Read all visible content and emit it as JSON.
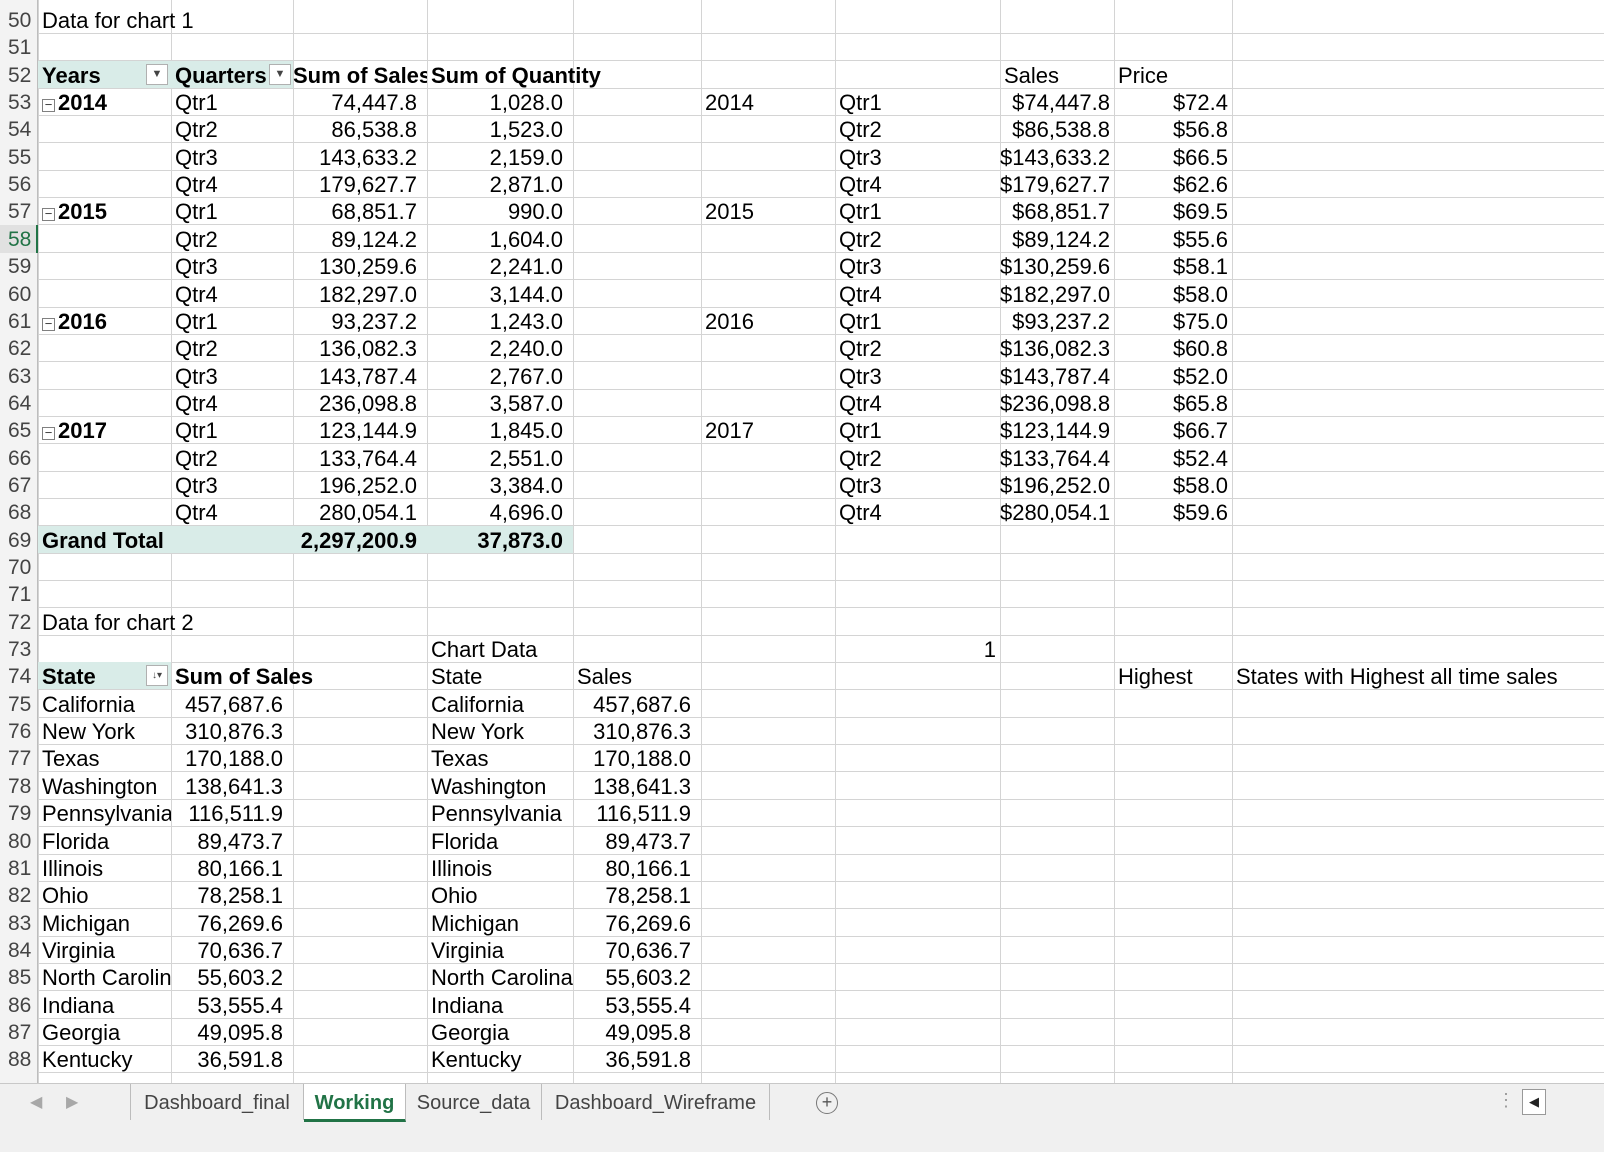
{
  "row_numbers": [
    "50",
    "51",
    "52",
    "53",
    "54",
    "55",
    "56",
    "57",
    "58",
    "59",
    "60",
    "61",
    "62",
    "63",
    "64",
    "65",
    "66",
    "67",
    "68",
    "69",
    "70",
    "71",
    "72",
    "73",
    "74",
    "75",
    "76",
    "77",
    "78",
    "79",
    "80",
    "81",
    "82",
    "83",
    "84",
    "85",
    "86",
    "87",
    "88"
  ],
  "section1": {
    "title": "Data for chart 1",
    "headers": {
      "years": "Years",
      "quarters": "Quarters",
      "sum_sales": "Sum of Sales",
      "sum_qty": "Sum of Quantity"
    },
    "rows": [
      {
        "year": "2014",
        "q": "Qtr1",
        "sales": "74,447.8",
        "qty": "1,028.0"
      },
      {
        "year": "",
        "q": "Qtr2",
        "sales": "86,538.8",
        "qty": "1,523.0"
      },
      {
        "year": "",
        "q": "Qtr3",
        "sales": "143,633.2",
        "qty": "2,159.0"
      },
      {
        "year": "",
        "q": "Qtr4",
        "sales": "179,627.7",
        "qty": "2,871.0"
      },
      {
        "year": "2015",
        "q": "Qtr1",
        "sales": "68,851.7",
        "qty": "990.0"
      },
      {
        "year": "",
        "q": "Qtr2",
        "sales": "89,124.2",
        "qty": "1,604.0"
      },
      {
        "year": "",
        "q": "Qtr3",
        "sales": "130,259.6",
        "qty": "2,241.0"
      },
      {
        "year": "",
        "q": "Qtr4",
        "sales": "182,297.0",
        "qty": "3,144.0"
      },
      {
        "year": "2016",
        "q": "Qtr1",
        "sales": "93,237.2",
        "qty": "1,243.0"
      },
      {
        "year": "",
        "q": "Qtr2",
        "sales": "136,082.3",
        "qty": "2,240.0"
      },
      {
        "year": "",
        "q": "Qtr3",
        "sales": "143,787.4",
        "qty": "2,767.0"
      },
      {
        "year": "",
        "q": "Qtr4",
        "sales": "236,098.8",
        "qty": "3,587.0"
      },
      {
        "year": "2017",
        "q": "Qtr1",
        "sales": "123,144.9",
        "qty": "1,845.0"
      },
      {
        "year": "",
        "q": "Qtr2",
        "sales": "133,764.4",
        "qty": "2,551.0"
      },
      {
        "year": "",
        "q": "Qtr3",
        "sales": "196,252.0",
        "qty": "3,384.0"
      },
      {
        "year": "",
        "q": "Qtr4",
        "sales": "280,054.1",
        "qty": "4,696.0"
      }
    ],
    "grand_total": {
      "label": "Grand Total",
      "sales": "2,297,200.9",
      "qty": "37,873.0"
    }
  },
  "side_table": {
    "headers": {
      "sales": "Sales",
      "price": "Price"
    },
    "rows": [
      {
        "year": "2014",
        "q": "Qtr1",
        "sales": "$74,447.8",
        "price": "$72.4"
      },
      {
        "year": "",
        "q": "Qtr2",
        "sales": "$86,538.8",
        "price": "$56.8"
      },
      {
        "year": "",
        "q": "Qtr3",
        "sales": "$143,633.2",
        "price": "$66.5"
      },
      {
        "year": "",
        "q": "Qtr4",
        "sales": "$179,627.7",
        "price": "$62.6"
      },
      {
        "year": "2015",
        "q": "Qtr1",
        "sales": "$68,851.7",
        "price": "$69.5"
      },
      {
        "year": "",
        "q": "Qtr2",
        "sales": "$89,124.2",
        "price": "$55.6"
      },
      {
        "year": "",
        "q": "Qtr3",
        "sales": "$130,259.6",
        "price": "$58.1"
      },
      {
        "year": "",
        "q": "Qtr4",
        "sales": "$182,297.0",
        "price": "$58.0"
      },
      {
        "year": "2016",
        "q": "Qtr1",
        "sales": "$93,237.2",
        "price": "$75.0"
      },
      {
        "year": "",
        "q": "Qtr2",
        "sales": "$136,082.3",
        "price": "$60.8"
      },
      {
        "year": "",
        "q": "Qtr3",
        "sales": "$143,787.4",
        "price": "$52.0"
      },
      {
        "year": "",
        "q": "Qtr4",
        "sales": "$236,098.8",
        "price": "$65.8"
      },
      {
        "year": "2017",
        "q": "Qtr1",
        "sales": "$123,144.9",
        "price": "$66.7"
      },
      {
        "year": "",
        "q": "Qtr2",
        "sales": "$133,764.4",
        "price": "$52.4"
      },
      {
        "year": "",
        "q": "Qtr3",
        "sales": "$196,252.0",
        "price": "$58.0"
      },
      {
        "year": "",
        "q": "Qtr4",
        "sales": "$280,054.1",
        "price": "$59.6"
      }
    ]
  },
  "section2": {
    "title": "Data for chart 2",
    "chart_data_label": "Chart Data",
    "selector_value": "1",
    "highest_label": "Highest",
    "highest_note": "States with Highest all time sales",
    "pivot_headers": {
      "state": "State",
      "sum_sales": "Sum of Sales"
    },
    "chart_headers": {
      "state": "State",
      "sales": "Sales"
    },
    "rows": [
      {
        "state": "California",
        "state_b": "California",
        "sales": "457,687.6"
      },
      {
        "state": "New York",
        "state_b": "New York",
        "sales": "310,876.3"
      },
      {
        "state": "Texas",
        "state_b": "Texas",
        "sales": "170,188.0"
      },
      {
        "state": "Washington",
        "state_b": "Washington",
        "sales": "138,641.3"
      },
      {
        "state": "Pennsylvania",
        "state_b": "Pennsylvania",
        "sales": "116,511.9"
      },
      {
        "state": "Florida",
        "state_b": "Florida",
        "sales": "89,473.7"
      },
      {
        "state": "Illinois",
        "state_b": "Illinois",
        "sales": "80,166.1"
      },
      {
        "state": "Ohio",
        "state_b": "Ohio",
        "sales": "78,258.1"
      },
      {
        "state": "Michigan",
        "state_b": "Michigan",
        "sales": "76,269.6"
      },
      {
        "state": "Virginia",
        "state_b": "Virginia",
        "sales": "70,636.7"
      },
      {
        "state": "North Carolina",
        "state_b": "North Carolina",
        "sales": "55,603.2"
      },
      {
        "state": "Indiana",
        "state_b": "Indiana",
        "sales": "53,555.4"
      },
      {
        "state": "Georgia",
        "state_b": "Georgia",
        "sales": "49,095.8"
      },
      {
        "state": "Kentucky",
        "state_b": "Kentucky",
        "sales": "36,591.8"
      }
    ]
  },
  "selected_row": "58",
  "tabs": [
    "Dashboard_final",
    "Working",
    "Source_data",
    "Dashboard_Wireframe"
  ],
  "active_tab": "Working",
  "icons": {
    "add_sheet": "plus-circle-icon",
    "filter": "dropdown-filter-icon",
    "sort_filter": "sort-desc-filter-icon",
    "collapse": "collapse-minus-icon"
  },
  "colors": {
    "pivot_band": "#d9ece8",
    "accent": "#217346"
  }
}
